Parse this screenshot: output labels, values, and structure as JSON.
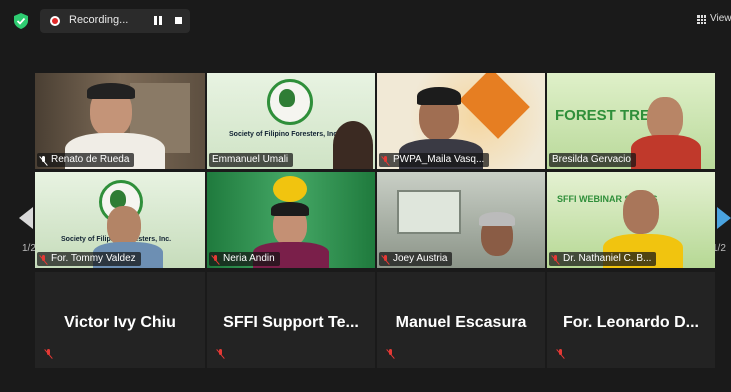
{
  "topbar": {
    "recording_label": "Recording...",
    "view_label": "View"
  },
  "colors": {
    "background": "#1a1a1a",
    "tile": "#232323",
    "active_speaker_border": "#e5e05a",
    "muted_mic": "#e53935",
    "shield": "#2ecc71",
    "next_arrow": "#4aa3df"
  },
  "icons": {
    "security": "shield-check-icon",
    "record": "record-dot-icon",
    "pause": "pause-icon",
    "stop": "stop-icon",
    "view": "grid-icon",
    "muted": "mic-muted-icon",
    "prev": "chevron-left-icon",
    "next": "chevron-right-icon"
  },
  "pagination": {
    "left": "1/2",
    "right": "1/2"
  },
  "tiles": [
    {
      "name": "Renato de Rueda",
      "active": true
    },
    {
      "name": "Emmanuel Umali",
      "banner": "Society of Filipino Foresters, Inc."
    },
    {
      "name": "PWPA_Maila Vasq..."
    },
    {
      "name": "Bresilda Gervacio",
      "banner": "FOREST TREK"
    },
    {
      "name": "For. Tommy Valdez",
      "banner": "Society of Filipino Foresters, Inc."
    },
    {
      "name": "Neria Andin"
    },
    {
      "name": "Joey Austria"
    },
    {
      "name": "Dr. Nathaniel C. B...",
      "banner": "SFFI WEBINAR SERIES"
    }
  ],
  "audio_only": [
    {
      "name": "Victor Ivy Chiu"
    },
    {
      "name": "SFFI Support Te..."
    },
    {
      "name": "Manuel Escasura"
    },
    {
      "name": "For. Leonardo D..."
    }
  ]
}
